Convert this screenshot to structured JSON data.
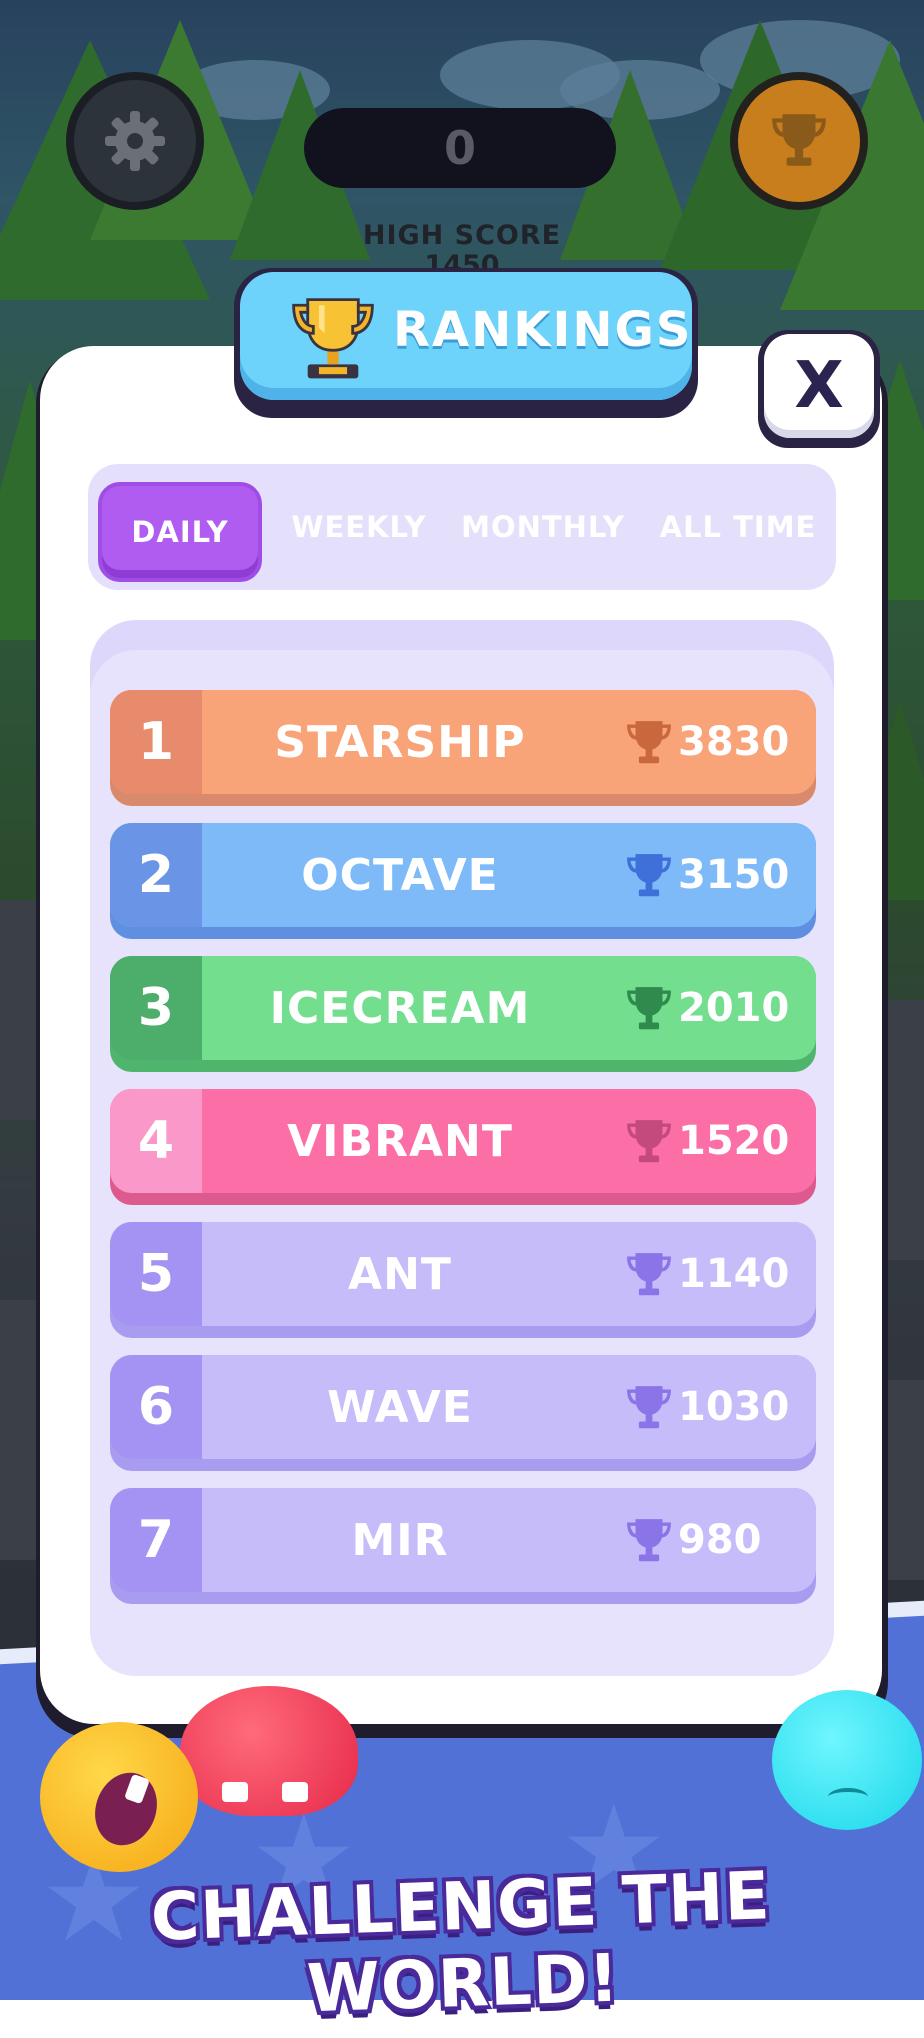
{
  "hud": {
    "score": "0",
    "high_score_label": "HIGH SCORE",
    "high_score_value": "1450"
  },
  "panel": {
    "title": "RANKINGS",
    "close_label": "X"
  },
  "tabs": [
    {
      "label": "DAILY",
      "active": true
    },
    {
      "label": "WEEKLY",
      "active": false
    },
    {
      "label": "MONTHLY",
      "active": false
    },
    {
      "label": "ALL TIME",
      "active": false
    }
  ],
  "leaderboard": [
    {
      "rank": "1",
      "name": "STARSHIP",
      "score": "3830",
      "color": "#f8a378",
      "rank_color": "#e88b6c",
      "shadow": "#d98a6c",
      "cup_color": "#c8683c"
    },
    {
      "rank": "2",
      "name": "OCTAVE",
      "score": "3150",
      "color": "#7dbaf7",
      "rank_color": "#6a95e6",
      "shadow": "#5f8fe0",
      "cup_color": "#3f6fd8"
    },
    {
      "rank": "3",
      "name": "ICECREAM",
      "score": "2010",
      "color": "#72de8e",
      "rank_color": "#4dad6a",
      "shadow": "#4fb56c",
      "cup_color": "#2f8a4e"
    },
    {
      "rank": "4",
      "name": "VIBRANT",
      "score": "1520",
      "color": "#fb6fa6",
      "rank_color": "#fa98c9",
      "shadow": "#dd5a8e",
      "cup_color": "#c44a7e"
    },
    {
      "rank": "5",
      "name": "ANT",
      "score": "1140",
      "color": "#c6bcfa",
      "rank_color": "#a593f3",
      "shadow": "#a89cf0",
      "cup_color": "#8a74e8"
    },
    {
      "rank": "6",
      "name": "WAVE",
      "score": "1030",
      "color": "#c6bcfa",
      "rank_color": "#a593f3",
      "shadow": "#a89cf0",
      "cup_color": "#8a74e8"
    },
    {
      "rank": "7",
      "name": "MIR",
      "score": "980",
      "color": "#c6bcfa",
      "rank_color": "#a593f3",
      "shadow": "#a89cf0",
      "cup_color": "#8a74e8"
    }
  ],
  "banner": "CHALLENGE THE WORLD!",
  "colors": {
    "accent_tab": "#b05cf0",
    "title_bar": "#6dd3fb",
    "ground": "#5171d6"
  }
}
